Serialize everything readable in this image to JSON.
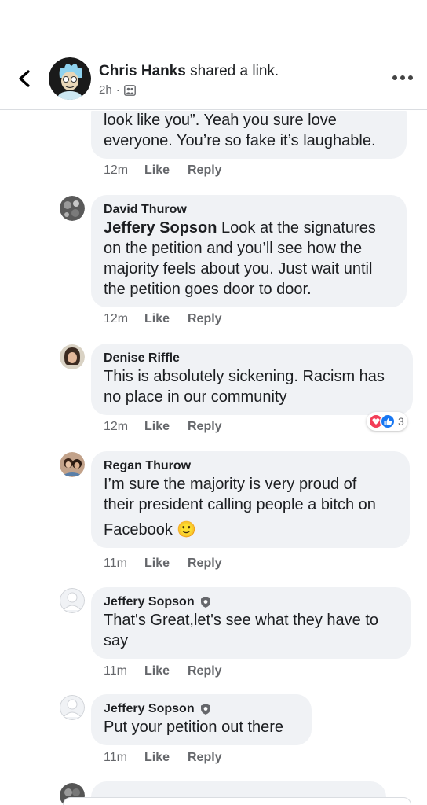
{
  "header": {
    "author": "Chris Hanks",
    "action": " shared a link.",
    "time": "2h",
    "separator": "·",
    "privacy_icon": "friends-icon"
  },
  "comments": [
    {
      "author": "",
      "lines": [
        "look like you”. Yeah you sure love",
        "everyone. You’re so fake it’s laughable."
      ],
      "time": "12m",
      "like": "Like",
      "reply": "Reply"
    },
    {
      "author": "David Thurow",
      "mention": "Jeffery Sopson",
      "lines": [
        " Look at the signatures",
        "on the petition and you’ll see how the",
        "majority feels about you. Just wait until",
        "the petition goes door to door."
      ],
      "time": "12m",
      "like": "Like",
      "reply": "Reply"
    },
    {
      "author": "Denise Riffle",
      "lines": [
        "This is absolutely sickening. Racism has",
        "no place in our community"
      ],
      "time": "12m",
      "like": "Like",
      "reply": "Reply",
      "reaction_count": "3"
    },
    {
      "author": "Regan Thurow",
      "lines": [
        "I’m sure the majority is very proud of",
        "their president calling people a bitch on",
        "Facebook 🙂"
      ],
      "time": "11m",
      "like": "Like",
      "reply": "Reply"
    },
    {
      "author": "Jeffery Sopson",
      "lines": [
        "That's Great,let's see what they have to",
        "say"
      ],
      "time": "11m",
      "like": "Like",
      "reply": "Reply"
    },
    {
      "author": "Jeffery Sopson",
      "lines": [
        "Put your petition out there"
      ],
      "time": "11m",
      "like": "Like",
      "reply": "Reply"
    }
  ],
  "colors": {
    "bubble": "#f0f2f5",
    "meta_text": "#65676b",
    "love": "#f33e58",
    "like": "#1877f2"
  }
}
